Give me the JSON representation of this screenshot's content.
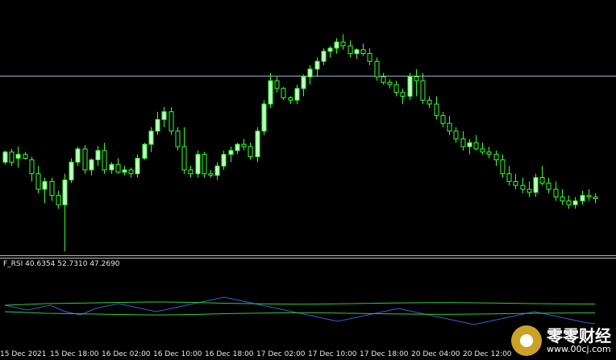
{
  "colors": {
    "background": "#000000",
    "bull_candle": "#c8ffc8",
    "bear_candle": "#000000",
    "candle_outline": "#33ff33",
    "horizontal_line": "#9fb5c4",
    "rsi_line": "#3b5bd6",
    "band_line": "#33cc33",
    "text": "#e8e8e8"
  },
  "indicator": {
    "label": "F_RSI 40.6354 52.7310 47.2690"
  },
  "time_axis": {
    "labels": [
      "15 Dec 2021",
      "15 Dec 18:00",
      "16 Dec 02:00",
      "16 Dec 10:00",
      "16 Dec 18:00",
      "17 Dec 02:00",
      "17 Dec 10:00",
      "17 Dec 18:00",
      "20 Dec 04:00",
      "20 Dec 12:00"
    ]
  },
  "watermark": {
    "name": "零零财经",
    "url": "www.00cj.com"
  },
  "chart_data": [
    {
      "type": "candlestick",
      "title": "",
      "x_labels": [
        "15 Dec 2021",
        "15 Dec 18:00",
        "16 Dec 02:00",
        "16 Dec 10:00",
        "16 Dec 18:00",
        "17 Dec 02:00",
        "17 Dec 10:00",
        "17 Dec 18:00",
        "20 Dec 04:00",
        "20 Dec 12:00"
      ],
      "y_axis_shown": false,
      "grid": false,
      "horizontal_line_level": 226,
      "ylim": [
        0,
        320
      ],
      "ohlc": [
        [
          115,
          112,
          130,
          128
        ],
        [
          128,
          110,
          132,
          115
        ],
        [
          120,
          108,
          135,
          125
        ],
        [
          125,
          118,
          128,
          120
        ],
        [
          118,
          90,
          122,
          100
        ],
        [
          100,
          75,
          110,
          80
        ],
        [
          80,
          62,
          95,
          90
        ],
        [
          90,
          65,
          95,
          72
        ],
        [
          72,
          55,
          78,
          60
        ],
        [
          60,
          0,
          100,
          92
        ],
        [
          92,
          88,
          120,
          115
        ],
        [
          115,
          110,
          135,
          132
        ],
        [
          132,
          100,
          137,
          105
        ],
        [
          105,
          98,
          120,
          118
        ],
        [
          118,
          110,
          136,
          130
        ],
        [
          130,
          100,
          140,
          105
        ],
        [
          105,
          100,
          115,
          112
        ],
        [
          112,
          100,
          120,
          102
        ],
        [
          102,
          98,
          110,
          105
        ],
        [
          105,
          95,
          108,
          100
        ],
        [
          100,
          95,
          125,
          120
        ],
        [
          120,
          118,
          140,
          138
        ],
        [
          138,
          128,
          160,
          155
        ],
        [
          155,
          150,
          180,
          170
        ],
        [
          170,
          160,
          186,
          180
        ],
        [
          180,
          150,
          186,
          155
        ],
        [
          155,
          130,
          160,
          135
        ],
        [
          135,
          100,
          160,
          105
        ],
        [
          105,
          95,
          110,
          100
        ],
        [
          100,
          95,
          130,
          125
        ],
        [
          125,
          95,
          128,
          100
        ],
        [
          100,
          95,
          105,
          98
        ],
        [
          98,
          92,
          115,
          110
        ],
        [
          110,
          105,
          130,
          125
        ],
        [
          125,
          115,
          135,
          130
        ],
        [
          130,
          125,
          140,
          138
        ],
        [
          138,
          130,
          145,
          135
        ],
        [
          135,
          118,
          140,
          122
        ],
        [
          122,
          115,
          160,
          155
        ],
        [
          155,
          150,
          195,
          190
        ],
        [
          190,
          185,
          230,
          220
        ],
        [
          220,
          205,
          225,
          210
        ],
        [
          210,
          195,
          212,
          198
        ],
        [
          198,
          190,
          200,
          195
        ],
        [
          195,
          190,
          215,
          210
        ],
        [
          210,
          200,
          228,
          225
        ],
        [
          225,
          215,
          240,
          235
        ],
        [
          235,
          225,
          250,
          245
        ],
        [
          245,
          240,
          262,
          258
        ],
        [
          258,
          250,
          265,
          262
        ],
        [
          262,
          255,
          275,
          270
        ],
        [
          270,
          260,
          280,
          265
        ],
        [
          265,
          250,
          272,
          255
        ],
        [
          255,
          248,
          262,
          260
        ],
        [
          260,
          252,
          268,
          255
        ],
        [
          255,
          240,
          262,
          245
        ],
        [
          245,
          220,
          250,
          225
        ],
        [
          225,
          215,
          230,
          218
        ],
        [
          218,
          210,
          222,
          215
        ],
        [
          215,
          200,
          220,
          205
        ],
        [
          205,
          190,
          210,
          200
        ],
        [
          200,
          195,
          230,
          225
        ],
        [
          225,
          200,
          235,
          220
        ],
        [
          220,
          190,
          230,
          195
        ],
        [
          195,
          185,
          200,
          190
        ],
        [
          190,
          170,
          200,
          175
        ],
        [
          175,
          160,
          180,
          165
        ],
        [
          165,
          150,
          175,
          155
        ],
        [
          155,
          140,
          160,
          145
        ],
        [
          145,
          130,
          155,
          135
        ],
        [
          135,
          125,
          145,
          140
        ],
        [
          140,
          130,
          150,
          132
        ],
        [
          132,
          125,
          140,
          128
        ],
        [
          128,
          120,
          135,
          125
        ],
        [
          125,
          110,
          130,
          118
        ],
        [
          118,
          95,
          125,
          100
        ],
        [
          100,
          85,
          110,
          90
        ],
        [
          90,
          80,
          100,
          85
        ],
        [
          85,
          75,
          95,
          80
        ],
        [
          80,
          70,
          90,
          76
        ],
        [
          76,
          70,
          100,
          95
        ],
        [
          95,
          85,
          110,
          88
        ],
        [
          88,
          75,
          95,
          80
        ],
        [
          80,
          65,
          90,
          70
        ],
        [
          70,
          60,
          80,
          65
        ],
        [
          65,
          55,
          72,
          60
        ],
        [
          60,
          55,
          70,
          65
        ],
        [
          65,
          60,
          78,
          72
        ],
        [
          72,
          65,
          80,
          70
        ],
        [
          70,
          62,
          75,
          68
        ]
      ]
    },
    {
      "type": "line",
      "title": "",
      "series": [
        {
          "name": "",
          "role": "rsi",
          "values": [
            52,
            51,
            50,
            49,
            50,
            51,
            52,
            50,
            48,
            47,
            46,
            48,
            50,
            51,
            52,
            53,
            52,
            51,
            50,
            49,
            48,
            49,
            50,
            51,
            52,
            53,
            54,
            55,
            56,
            57,
            56,
            55,
            54,
            53,
            52,
            51,
            50,
            49,
            48,
            47,
            46,
            45,
            44,
            43,
            42,
            43,
            44,
            45,
            46,
            47,
            48,
            49,
            50,
            49,
            48,
            47,
            46,
            45,
            44,
            43,
            42,
            41,
            40,
            41,
            42,
            43,
            44,
            45,
            46,
            47,
            48,
            47,
            46,
            45,
            44,
            43,
            42,
            41,
            40.6354
          ]
        },
        {
          "name": "",
          "role": "upper_band",
          "values": [
            52,
            52.5,
            53,
            53.2,
            53.4,
            53.6,
            53.8,
            54,
            54,
            53.8,
            53.5,
            53.2,
            53,
            52.8,
            52.7,
            52.7,
            52.8,
            53,
            53.2,
            53.4,
            53.5,
            53.6,
            53.6,
            53.5,
            53.4,
            53.2,
            53,
            52.9,
            52.8,
            52.731
          ]
        },
        {
          "name": "",
          "role": "lower_band",
          "values": [
            48,
            47.5,
            47,
            46.8,
            46.6,
            46.4,
            46.2,
            46,
            46,
            46.2,
            46.5,
            46.8,
            47,
            47.2,
            47.3,
            47.3,
            47.2,
            47,
            46.8,
            46.6,
            46.5,
            46.4,
            46.4,
            46.5,
            46.6,
            46.8,
            47,
            47.1,
            47.2,
            47.269
          ]
        }
      ]
    }
  ]
}
